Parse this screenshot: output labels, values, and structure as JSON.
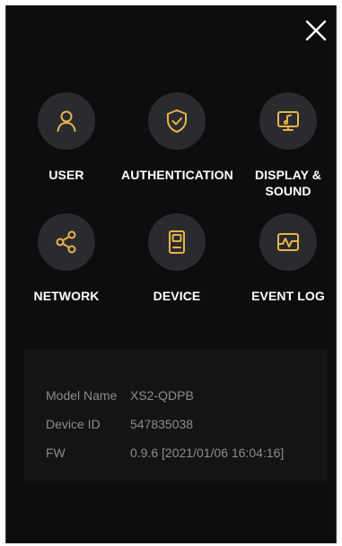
{
  "close": {
    "icon": "close-icon"
  },
  "menu": {
    "items": [
      {
        "label": "USER",
        "icon": "user-icon"
      },
      {
        "label": "AUTHENTICATION",
        "icon": "shield-check-icon"
      },
      {
        "label": "DISPLAY &\nSOUND",
        "icon": "monitor-music-icon"
      },
      {
        "label": "NETWORK",
        "icon": "share-icon"
      },
      {
        "label": "DEVICE",
        "icon": "device-icon"
      },
      {
        "label": "EVENT LOG",
        "icon": "event-log-icon"
      }
    ]
  },
  "info": {
    "rows": [
      {
        "key": "Model Name",
        "value": "XS2-QDPB"
      },
      {
        "key": "Device ID",
        "value": "547835038"
      },
      {
        "key": "FW",
        "value": "0.9.6 [2021/01/06 16:04:16]"
      }
    ]
  },
  "colors": {
    "background": "#0d0d0e",
    "icon_circle": "#2a2b2f",
    "accent_gold": "#e8b44a",
    "label": "#ffffff",
    "info_text": "#8c8c8c"
  }
}
